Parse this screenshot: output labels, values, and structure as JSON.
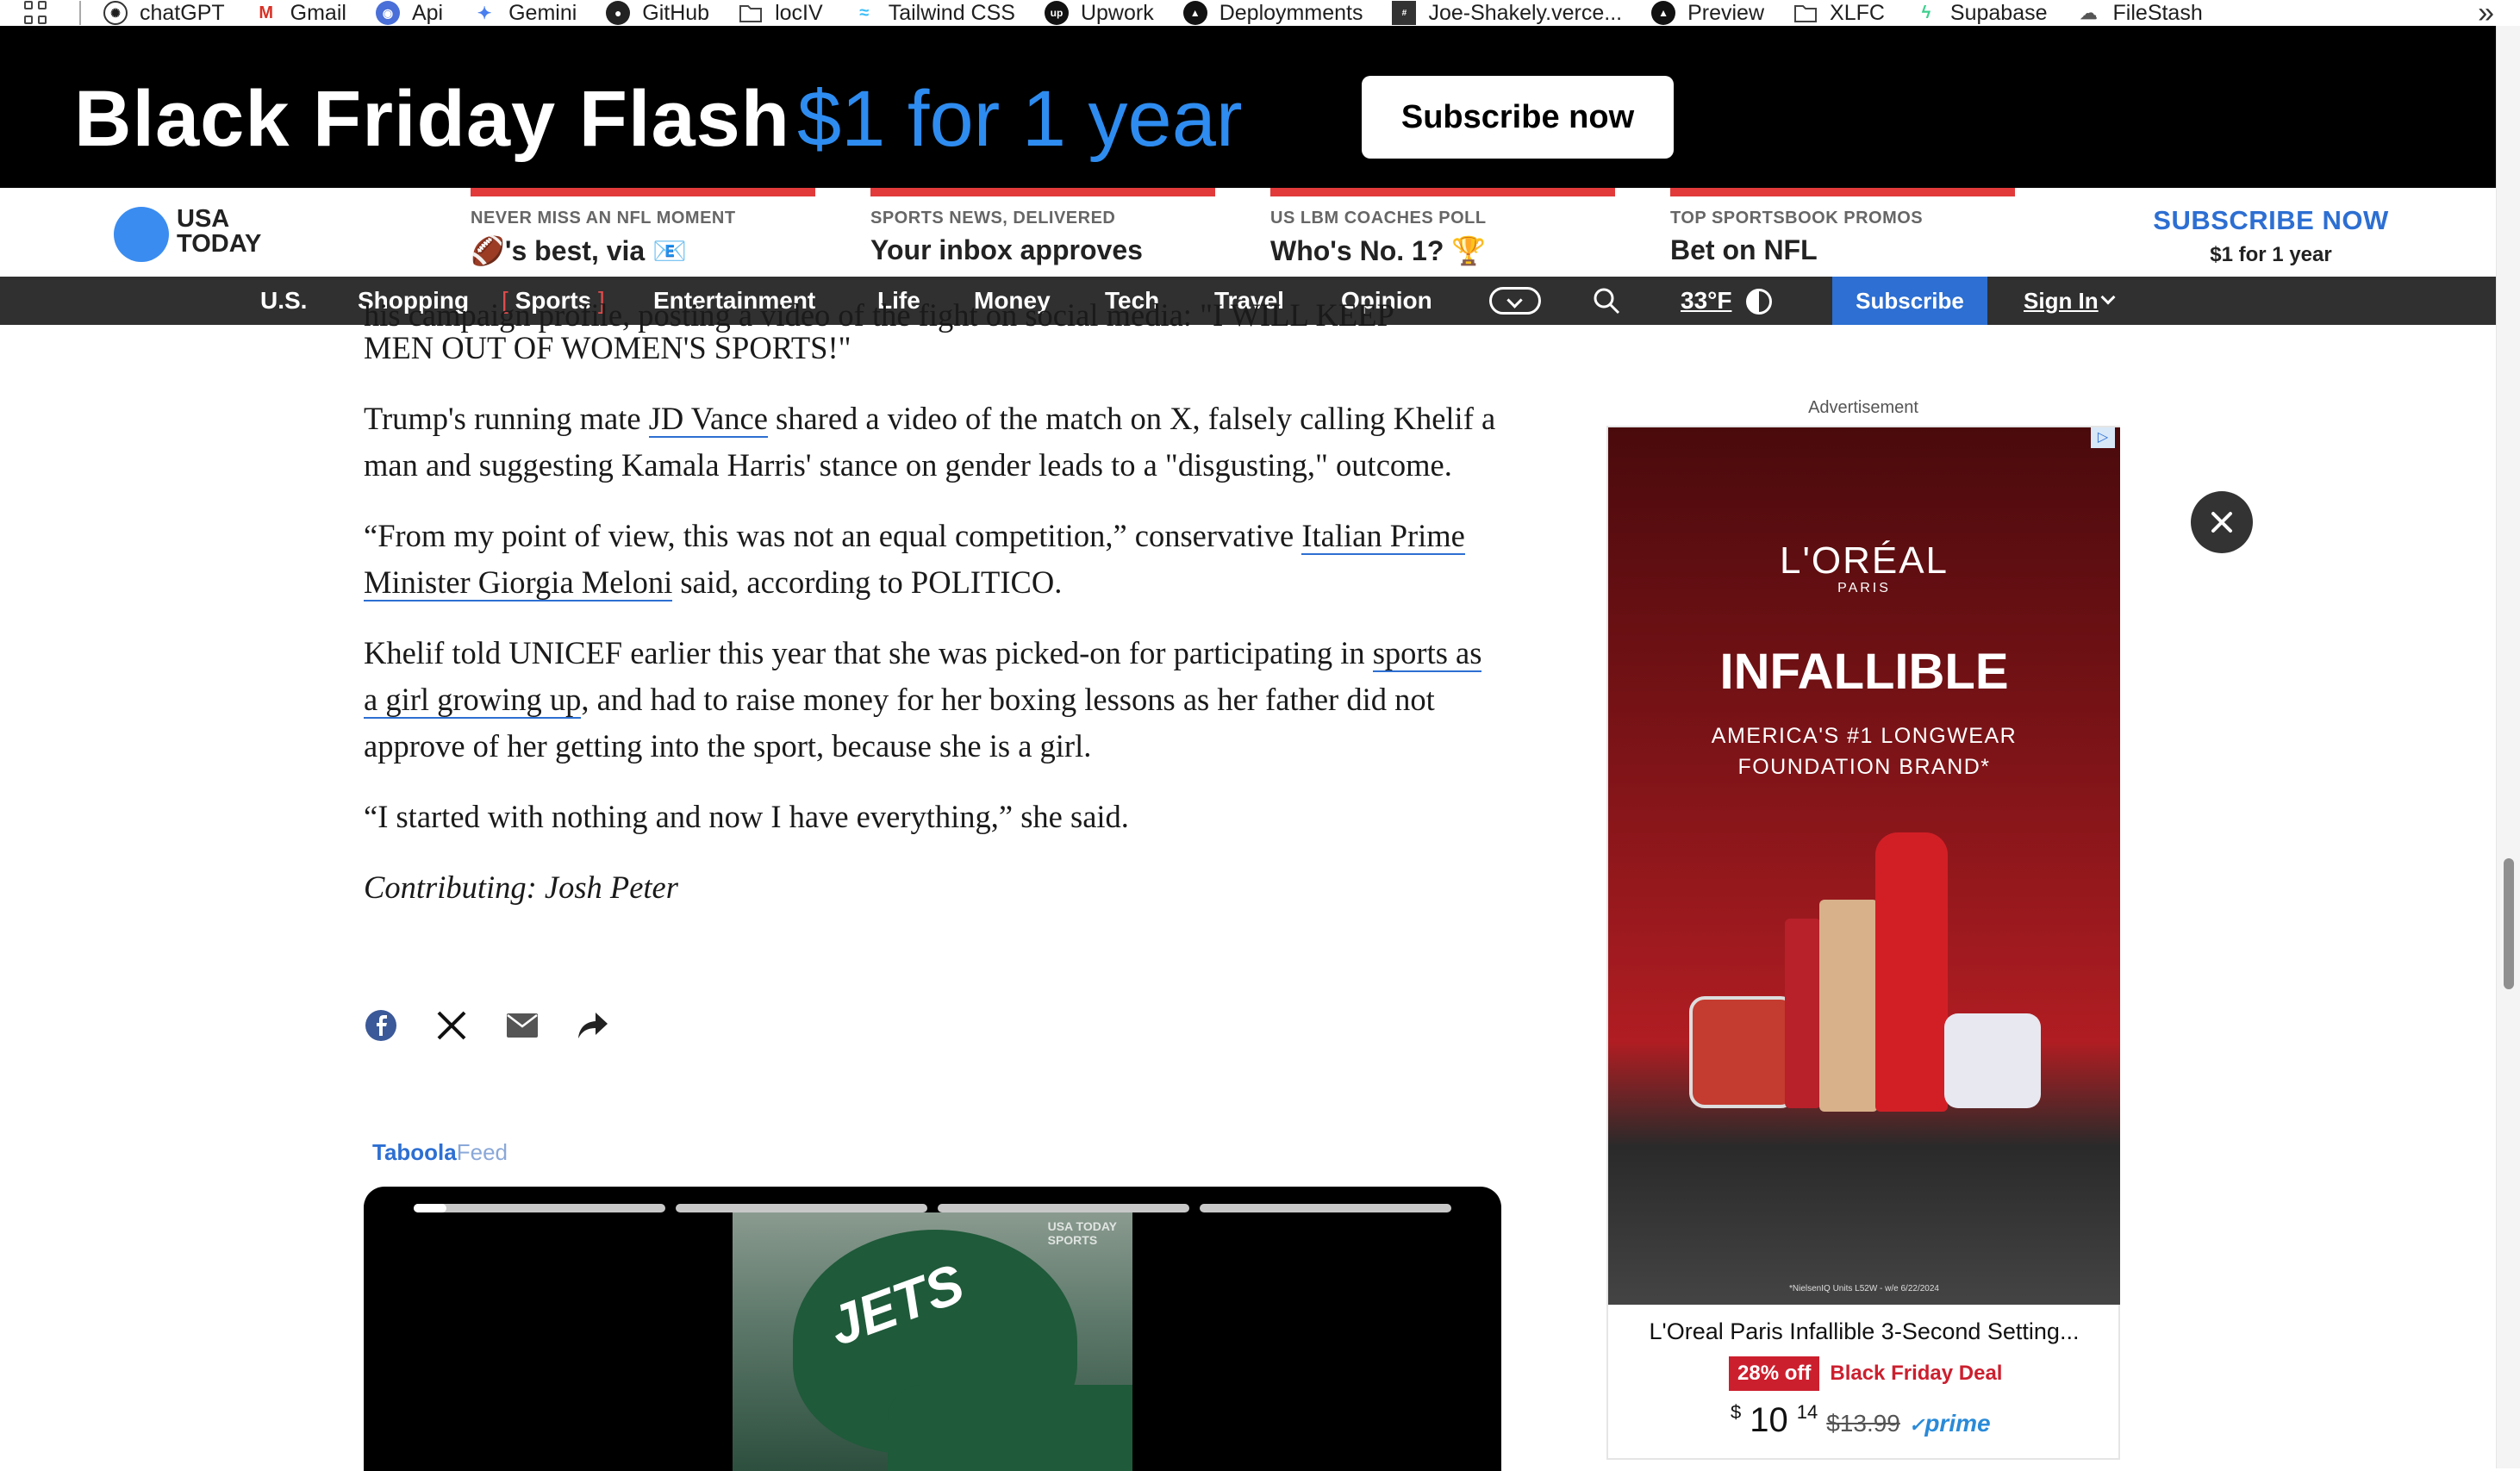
{
  "bookmarks": {
    "items": [
      {
        "label": "chatGPT",
        "icon": "chatgpt-icon"
      },
      {
        "label": "Gmail",
        "icon": "gmail-icon"
      },
      {
        "label": "Api",
        "icon": "api-icon"
      },
      {
        "label": "Gemini",
        "icon": "gemini-icon"
      },
      {
        "label": "GitHub",
        "icon": "github-icon"
      },
      {
        "label": "locIV",
        "icon": "folder-icon"
      },
      {
        "label": "Tailwind CSS",
        "icon": "tailwind-icon"
      },
      {
        "label": "Upwork",
        "icon": "upwork-icon"
      },
      {
        "label": "Deploymments",
        "icon": "vercel-icon"
      },
      {
        "label": "Joe-Shakely.verce...",
        "icon": "site-icon"
      },
      {
        "label": "Preview",
        "icon": "vercel-icon"
      },
      {
        "label": "XLFC",
        "icon": "folder-icon"
      },
      {
        "label": "Supabase",
        "icon": "supabase-icon"
      },
      {
        "label": "FileStash",
        "icon": "cloud-icon"
      }
    ],
    "more": "»"
  },
  "promo": {
    "title": "Black Friday Flash",
    "price": "$1 for 1 year",
    "button": "Subscribe now"
  },
  "masthead": {
    "logo_line1": "USA",
    "logo_line2": "TODAY",
    "slots": [
      {
        "kicker": "NEVER MISS AN NFL MOMENT",
        "headline": "🏈's best, via 📧"
      },
      {
        "kicker": "SPORTS NEWS, DELIVERED",
        "headline": "Your inbox approves"
      },
      {
        "kicker": "US LBM COACHES POLL",
        "headline": "Who's No. 1? 🏆"
      },
      {
        "kicker": "TOP SPORTSBOOK PROMOS",
        "headline": "Bet on NFL"
      }
    ],
    "subscribe_title": "SUBSCRIBE NOW",
    "subscribe_sub": "$1 for 1 year"
  },
  "nav": {
    "items": [
      "U.S.",
      "Shopping",
      "Sports",
      "Entertainment",
      "Life",
      "Money",
      "Tech",
      "Travel",
      "Opinion"
    ],
    "bracket_open": "[",
    "bracket_close": "]",
    "temperature": "33°F",
    "subscribe": "Subscribe",
    "sign_in": "Sign In"
  },
  "article": {
    "clipped_line": "his campaign profile, posting a video of the fight on social media: \"I WILL KEEP",
    "p0": "MEN OUT OF WOMEN'S SPORTS!\"",
    "p1_pre": "Trump's running mate ",
    "p1_link": "JD Vance",
    "p1_post": " shared a video of the match on X, falsely calling Khelif a man and suggesting Kamala Harris' stance on gender leads to a \"disgusting,\" outcome.",
    "p2_pre": "“From my point of view, this was not an equal competition,” conservative ",
    "p2_link": "Italian Prime Minister Giorgia Meloni",
    "p2_post": " said, according to POLITICO.",
    "p3_pre": "Khelif told UNICEF earlier this year that she was picked-on for participating in ",
    "p3_link": "sports as a girl growing up",
    "p3_post": ", and had to raise money for her boxing lessons as her father did not approve of her getting into the sport, because she is a girl.",
    "p4": "“I started with nothing and now I have everything,” she said.",
    "contributing": "Contributing: Josh Peter"
  },
  "share": [
    "facebook-icon",
    "x-icon",
    "email-icon",
    "share-icon"
  ],
  "taboola": {
    "brand": "Taboola",
    "feed": "Feed"
  },
  "video": {
    "watermark_line1": "USA TODAY",
    "watermark_line2": "SPORTS",
    "helmet_text": "JETS",
    "progress": [
      0.13,
      0,
      0,
      0
    ]
  },
  "ad": {
    "label": "Advertisement",
    "brand": "L'ORÉAL",
    "brand_sub": "PARIS",
    "product": "INFALLIBLE",
    "tagline_1": "AMERICA'S #1 LONGWEAR",
    "tagline_2": "FOUNDATION BRAND*",
    "fine_print": "*NielsenIQ Units L52W - w/e 6/22/2024",
    "title": "L'Oreal Paris Infallible 3-Second Setting...",
    "discount": "28% off",
    "deal": "Black Friday Deal",
    "price_currency": "$",
    "price_whole": "10",
    "price_cents": "14",
    "old_price": "$13.99",
    "prime": "prime"
  },
  "colors": {
    "accent_blue": "#2d6fd2",
    "promo_blue": "#2e8cf0",
    "accent_red": "#e23a3a",
    "nav_bg": "#303030"
  }
}
